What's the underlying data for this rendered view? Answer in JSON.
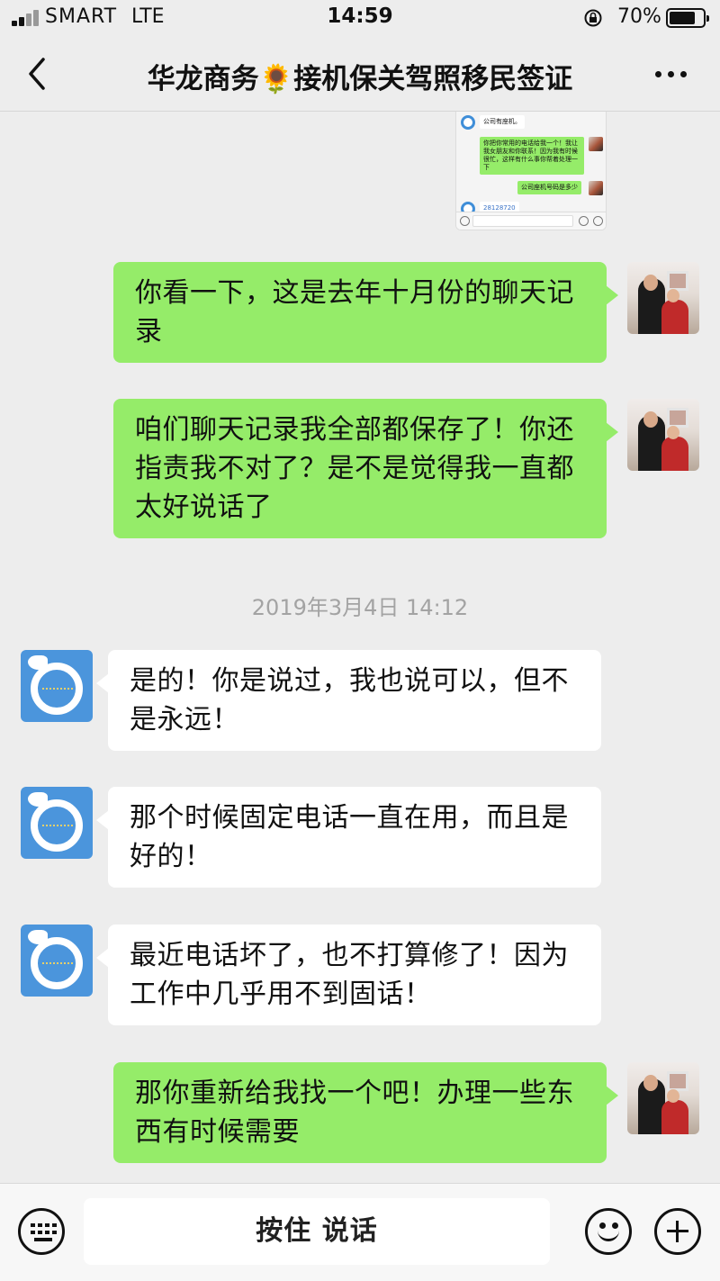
{
  "status_bar": {
    "carrier": "SMART",
    "network": "LTE",
    "time": "14:59",
    "battery_percent": "70%",
    "battery_level": 0.7
  },
  "nav": {
    "title": "华龙商务🌻接机保关驾照移民签证"
  },
  "embedded_screenshot": {
    "msg1": "公司有座机。",
    "msg2": "你把你常用的电话给我一个！我让我女朋友和你联系！因为我有时候很忙，这样有什么事你帮着处理一下",
    "msg3": "公司座机号码是多少",
    "msg4": "28128720"
  },
  "messages": [
    {
      "side": "right",
      "text": "你看一下，这是去年十月份的聊天记录"
    },
    {
      "side": "right",
      "text": "咱们聊天记录我全部都保存了！你还指责我不对了？是不是觉得我一直都太好说话了"
    },
    {
      "side": "left",
      "text": "是的！你是说过，我也说可以，但不是永远！"
    },
    {
      "side": "left",
      "text": "那个时候固定电话一直在用，而且是好的！"
    },
    {
      "side": "left",
      "text": "最近电话坏了，也不打算修了！因为工作中几乎用不到固话！"
    },
    {
      "side": "right",
      "text": "那你重新给我找一个吧！办理一些东西有时候需要"
    }
  ],
  "timestamp": "2019年3月4日 14:12",
  "input_bar": {
    "voice_label": "按住 说话"
  }
}
